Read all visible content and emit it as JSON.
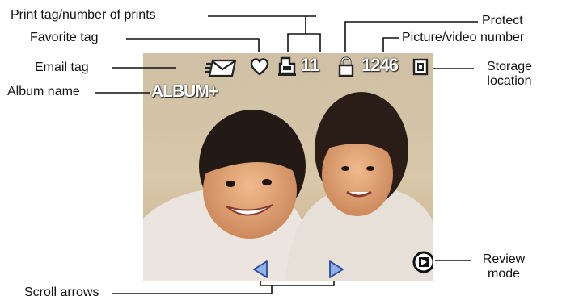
{
  "callouts": {
    "print_tag": "Print tag/number of prints",
    "favorite_tag": "Favorite tag",
    "email_tag": "Email tag",
    "album_name": "Album name",
    "protect": "Protect",
    "picture_number": "Picture/video number",
    "storage_line1": "Storage",
    "storage_line2": "location",
    "review_line1": "Review",
    "review_line2": "mode",
    "scroll_arrows": "Scroll arrows"
  },
  "screen": {
    "album_name": "ALBUM+",
    "print_count": "11",
    "picture_number": "1246"
  },
  "icons": [
    "email-icon",
    "heart-icon",
    "print-icon",
    "lock-icon",
    "storage-card-icon",
    "review-play-icon",
    "scroll-left-icon",
    "scroll-right-icon"
  ],
  "colors": {
    "arrow_fill": "#8fb0e8",
    "arrow_stroke": "#2a4a9a"
  }
}
